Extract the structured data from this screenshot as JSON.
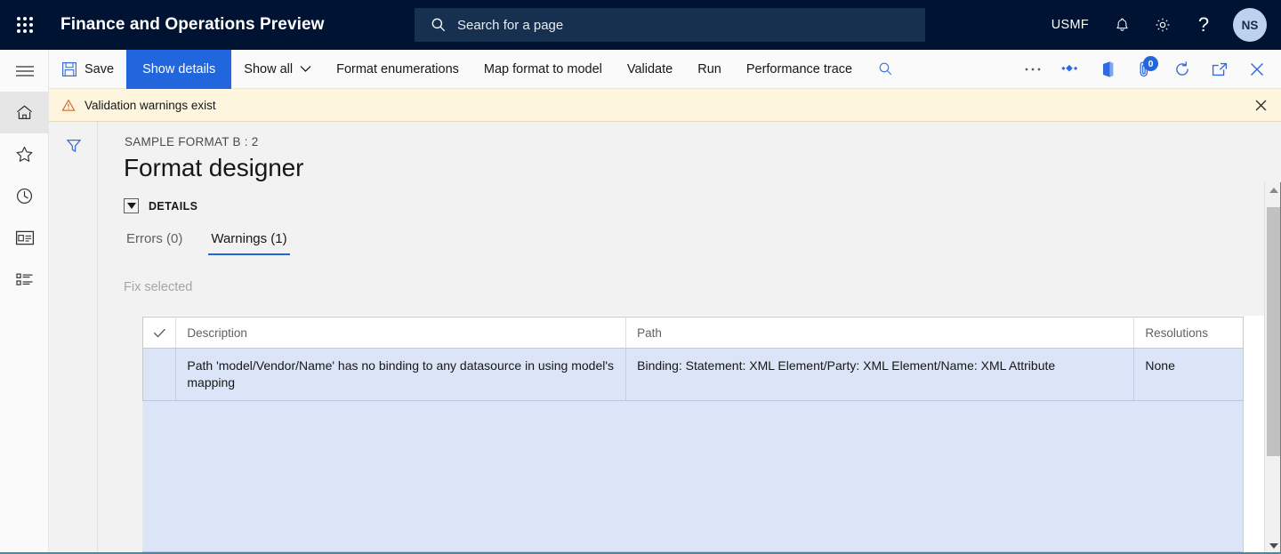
{
  "topbar": {
    "waffle_label": "app-launcher",
    "app_title": "Finance and Operations Preview",
    "search": {
      "placeholder": "Search for a page",
      "value": "",
      "icon": "search-icon"
    },
    "company": "USMF",
    "notifications_icon": "bell-icon",
    "settings_icon": "gear-icon",
    "help_icon": "question-mark-icon",
    "avatar_initials": "NS"
  },
  "rail": {
    "items": [
      {
        "icon": "hamburger-menu-icon",
        "name": "nav-expand",
        "active": false
      },
      {
        "icon": "home-icon",
        "name": "home",
        "active": true
      },
      {
        "icon": "star-icon",
        "name": "favorites",
        "active": false
      },
      {
        "icon": "clock-icon",
        "name": "recent",
        "active": false
      },
      {
        "icon": "workspaces-icon",
        "name": "workspaces",
        "active": false
      },
      {
        "icon": "list-icon",
        "name": "modules",
        "active": false
      }
    ]
  },
  "action_pane": {
    "save_label": "Save",
    "save_icon": "save-disk-icon",
    "buttons": [
      {
        "label": "Show details",
        "primary": true,
        "caret": false
      },
      {
        "label": "Show all",
        "primary": false,
        "caret": true
      },
      {
        "label": "Format enumerations",
        "primary": false,
        "caret": false
      },
      {
        "label": "Map format to model",
        "primary": false,
        "caret": false
      },
      {
        "label": "Validate",
        "primary": false,
        "caret": false
      },
      {
        "label": "Run",
        "primary": false,
        "caret": false
      },
      {
        "label": "Performance trace",
        "primary": false,
        "caret": false
      }
    ],
    "filter_icon": "search-icon",
    "right_icons": [
      {
        "icon": "overflow-ellipsis-icon",
        "name": "more-options",
        "badge": null
      },
      {
        "icon": "share-diamonds-icon",
        "name": "share",
        "badge": null
      },
      {
        "icon": "office-app-icon",
        "name": "open-in-office",
        "badge": null
      },
      {
        "icon": "attachment-icon",
        "name": "attachments",
        "badge": "0"
      },
      {
        "icon": "refresh-icon",
        "name": "refresh",
        "badge": null
      },
      {
        "icon": "popout-icon",
        "name": "open-in-new-window",
        "badge": null
      },
      {
        "icon": "close-icon",
        "name": "close-page",
        "badge": null
      }
    ]
  },
  "message_bar": {
    "icon": "warning-triangle-icon",
    "text": "Validation warnings exist",
    "close_icon": "close-icon"
  },
  "filter_strip": {
    "icon": "filter-funnel-icon",
    "name": "filter-pane-toggle"
  },
  "page": {
    "breadcrumb": "SAMPLE FORMAT B : 2",
    "title": "Format designer",
    "section": {
      "label": "DETAILS",
      "expanded": true,
      "caret_icon": "caret-down-icon"
    },
    "tabs": [
      {
        "label": "Errors (0)",
        "active": false
      },
      {
        "label": "Warnings (1)",
        "active": true
      }
    ],
    "fix_selected_label": "Fix selected"
  },
  "grid": {
    "select_all_icon": "checkmark-icon",
    "columns": [
      "Description",
      "Path",
      "Resolutions"
    ],
    "rows": [
      {
        "selected": true,
        "description": "Path 'model/Vendor/Name' has no binding to any datasource in using model's mapping",
        "path": "Binding: Statement: XML Element/Party: XML Element/Name: XML Attribute",
        "resolutions": "None"
      }
    ]
  },
  "scrollbar": {
    "up_icon": "triangle-up-icon",
    "down_icon": "triangle-down-icon",
    "thumb_name": "vertical-scroll-thumb"
  },
  "colors": {
    "brand_navy": "#001333",
    "accent_blue": "#2266dd",
    "warning_bg": "#fdf5dd",
    "row_selected": "#dbe5f7",
    "teal_rule": "#4b8a9e"
  }
}
